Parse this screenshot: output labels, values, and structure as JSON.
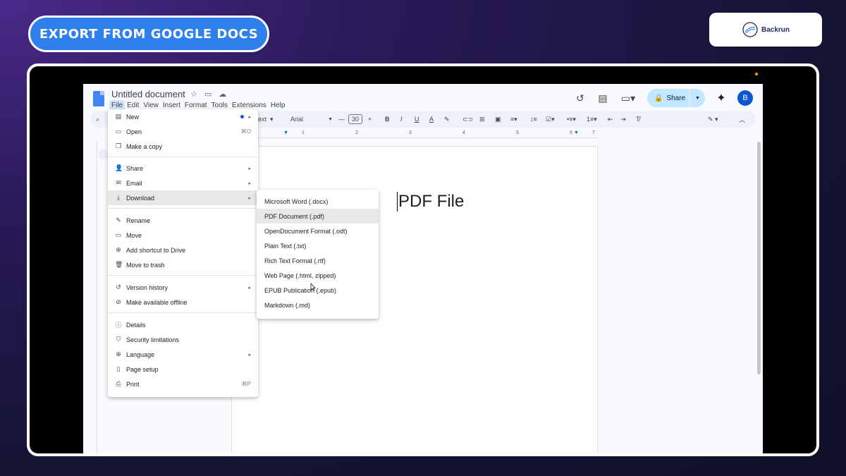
{
  "banner": {
    "title": "EXPORT FROM GOOGLE DOCS"
  },
  "brand": {
    "name": "Backrun"
  },
  "doc": {
    "title": "Untitled document",
    "menubar": [
      "File",
      "Edit",
      "View",
      "Insert",
      "Format",
      "Tools",
      "Extensions",
      "Help"
    ],
    "share_label": "Share",
    "avatar_letter": "B",
    "toolbar": {
      "style": "ext",
      "font": "Arial",
      "size": "30"
    },
    "ruler": [
      "1",
      "2",
      "3",
      "4",
      "5",
      "6",
      "7"
    ],
    "body_text": "PDF File"
  },
  "file_menu": {
    "items": [
      {
        "label": "New",
        "icon": "doc-icon"
      },
      {
        "label": "Open",
        "icon": "folder-icon",
        "shortcut": "⌘O"
      },
      {
        "label": "Make a copy",
        "icon": "copy-icon"
      },
      {
        "label": "Share",
        "icon": "person-add-icon"
      },
      {
        "label": "Email",
        "icon": "mail-icon"
      },
      {
        "label": "Download",
        "icon": "download-icon"
      },
      {
        "label": "Rename",
        "icon": "pencil-icon"
      },
      {
        "label": "Move",
        "icon": "move-folder-icon"
      },
      {
        "label": "Add shortcut to Drive",
        "icon": "drive-shortcut-icon"
      },
      {
        "label": "Move to trash",
        "icon": "trash-icon"
      },
      {
        "label": "Version history",
        "icon": "history-icon"
      },
      {
        "label": "Make available offline",
        "icon": "offline-icon"
      },
      {
        "label": "Details",
        "icon": "info-icon"
      },
      {
        "label": "Security limitations",
        "icon": "shield-icon"
      },
      {
        "label": "Language",
        "icon": "globe-icon"
      },
      {
        "label": "Page setup",
        "icon": "page-setup-icon"
      },
      {
        "label": "Print",
        "icon": "print-icon",
        "shortcut": "⌘P"
      }
    ]
  },
  "download_menu": {
    "items": [
      "Microsoft Word (.docx)",
      "PDF Document (.pdf)",
      "OpenDocument Format (.odt)",
      "Plain Text (.txt)",
      "Rich Text Format (.rtf)",
      "Web Page (.html, zipped)",
      "EPUB Publication (.epub)",
      "Markdown (.md)"
    ]
  },
  "colors": {
    "banner": "#2f80ed",
    "highlight": "#e8e8e8",
    "share": "#c2e7ff",
    "accent": "#0b57d0"
  }
}
